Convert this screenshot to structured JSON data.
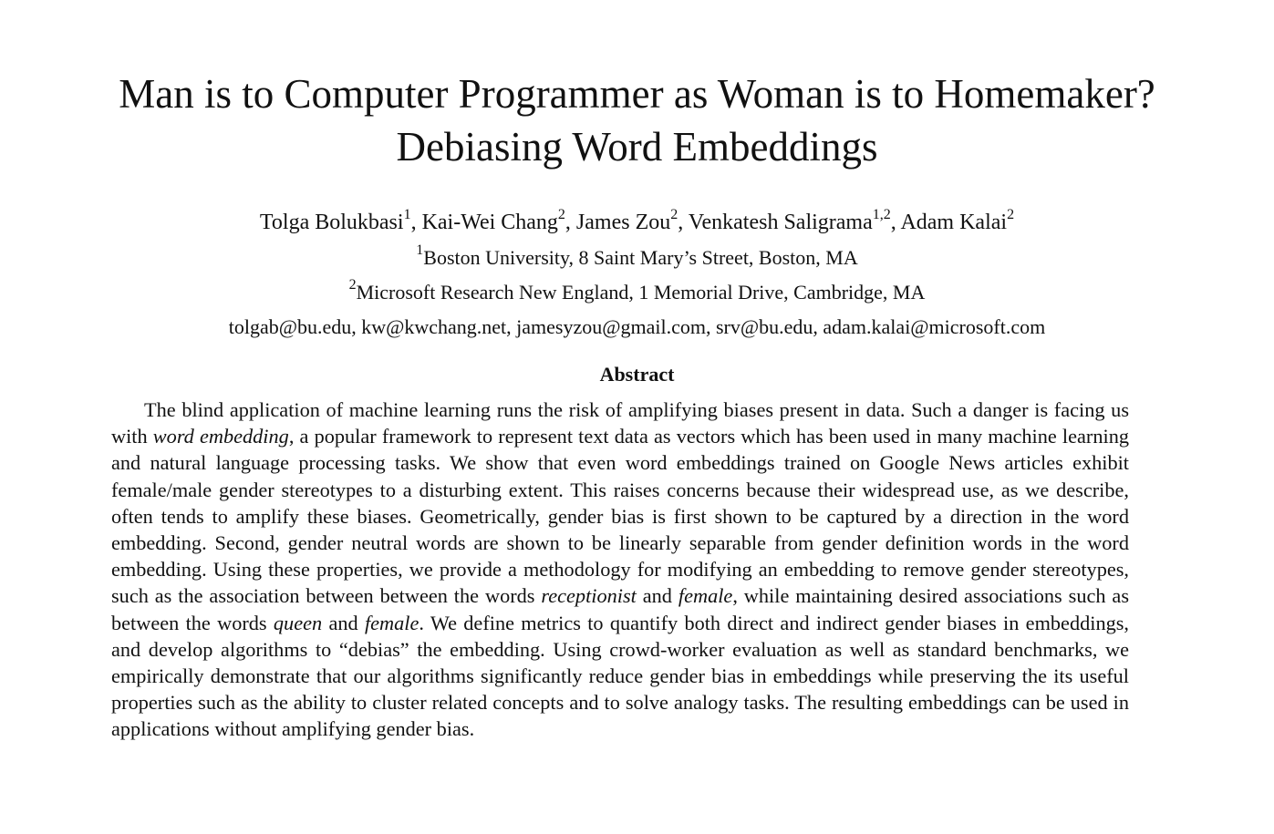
{
  "title": {
    "line1": "Man is to Computer Programmer as Woman is to Homemaker?",
    "line2": "Debiasing Word Embeddings"
  },
  "authors": [
    {
      "name": "Tolga Bolukbasi",
      "sup": "1",
      "sep": ", "
    },
    {
      "name": "Kai-Wei Chang",
      "sup": "2",
      "sep": ", "
    },
    {
      "name": "James Zou",
      "sup": "2",
      "sep": ", "
    },
    {
      "name": "Venkatesh Saligrama",
      "sup": "1,2",
      "sep": ", "
    },
    {
      "name": "Adam Kalai",
      "sup": "2",
      "sep": ""
    }
  ],
  "affiliations": [
    {
      "sup": "1",
      "text": "Boston University, 8 Saint Mary’s Street, Boston, MA"
    },
    {
      "sup": "2",
      "text": "Microsoft Research New England, 1 Memorial Drive, Cambridge, MA"
    }
  ],
  "emails": "tolgab@bu.edu, kw@kwchang.net, jamesyzou@gmail.com, srv@bu.edu, adam.kalai@microsoft.com",
  "abstract": {
    "heading": "Abstract",
    "segments": [
      {
        "text": "The blind application of machine learning runs the risk of amplifying biases present in data. Such a danger is facing us with ",
        "italic": false
      },
      {
        "text": "word embedding",
        "italic": true
      },
      {
        "text": ", a popular framework to represent text data as vectors which has been used in many machine learning and natural language processing tasks. We show that even word embeddings trained on Google News articles exhibit female/male gender stereotypes to a disturbing extent. This raises concerns because their widespread use, as we describe, often tends to amplify these biases. Geometrically, gender bias is first shown to be captured by a direction in the word embedding. Second, gender neutral words are shown to be linearly separable from gender definition words in the word embedding. Using these properties, we provide a methodology for modifying an embedding to remove gender stereotypes, such as the association between between the words ",
        "italic": false
      },
      {
        "text": "receptionist",
        "italic": true
      },
      {
        "text": " and ",
        "italic": false
      },
      {
        "text": "female",
        "italic": true
      },
      {
        "text": ", while maintaining desired associations such as between the words ",
        "italic": false
      },
      {
        "text": "queen",
        "italic": true
      },
      {
        "text": " and ",
        "italic": false
      },
      {
        "text": "female",
        "italic": true
      },
      {
        "text": ". We define metrics to quantify both direct and indirect gender biases in embeddings, and develop algorithms to “debias” the embedding. Using crowd-worker evaluation as well as standard benchmarks, we empirically demonstrate that our algorithms significantly reduce gender bias in embeddings while preserving the its useful properties such as the ability to cluster related concepts and to solve analogy tasks. The resulting embeddings can be used in applications without amplifying gender bias.",
        "italic": false
      }
    ]
  }
}
